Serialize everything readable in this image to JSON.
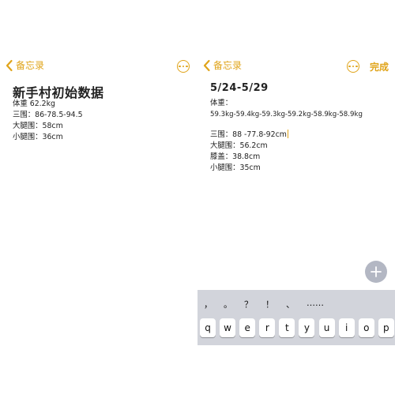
{
  "left_note": {
    "back_label": "备忘录",
    "title": "新手村初始数据",
    "lines": [
      "体重 62.2kg",
      "三围：86-78.5-94.5",
      "大腿围：58cm",
      "小腿围：36cm"
    ]
  },
  "right_note": {
    "back_label": "备忘录",
    "done_label": "完成",
    "title": "5/24-5/29",
    "weight_label": "体重：",
    "weight_values": "59.3kg-59.4kg-59.3kg-59.2kg-58.9kg-58.9kg",
    "measurements": [
      "三围：88 -77.8-92cm",
      "大腿围：56.2cm",
      "膝盖：38.8cm",
      "小腿围：35cm"
    ]
  },
  "keyboard": {
    "candidates": [
      "，",
      "。",
      "？",
      "！",
      "、",
      "……"
    ],
    "row1": [
      "q",
      "w",
      "e",
      "r",
      "t",
      "y",
      "u",
      "i",
      "o",
      "p"
    ]
  },
  "icons": {
    "back": "chevron-left-icon",
    "more": "ellipsis-circle-icon",
    "add": "plus-icon"
  },
  "colors": {
    "accent": "#e0a41a",
    "keyboard_bg": "#d2d4db",
    "fab": "#b3b7c3"
  }
}
